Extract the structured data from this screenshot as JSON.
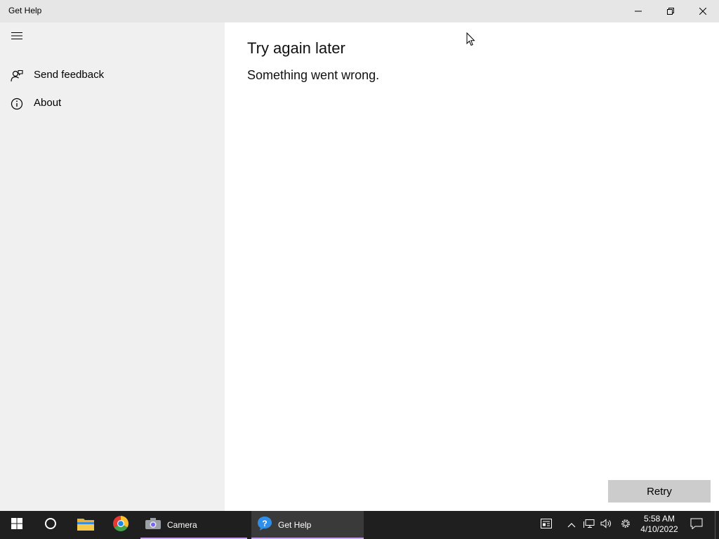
{
  "window": {
    "title": "Get Help",
    "controls": [
      "minimize-icon",
      "restore-icon",
      "close-icon"
    ]
  },
  "sidebar": {
    "menu_icon": "hamburger-icon",
    "items": [
      {
        "label": "Send feedback",
        "icon": "feedback-icon"
      },
      {
        "label": "About",
        "icon": "info-icon"
      }
    ]
  },
  "main": {
    "heading": "Try again later",
    "message": "Something went wrong.",
    "retry_label": "Retry"
  },
  "taskbar": {
    "start_icon": "windows-start-icon",
    "search_icon": "cortana-circle-icon",
    "pinned": [
      {
        "name": "file-explorer-icon"
      },
      {
        "name": "chrome-icon"
      }
    ],
    "apps": [
      {
        "label": "Camera",
        "icon": "camera-icon",
        "active": false
      },
      {
        "label": "Get Help",
        "icon": "get-help-icon",
        "active": true
      }
    ],
    "tray": {
      "time": "5:58 AM",
      "date": "4/10/2022"
    }
  },
  "colors": {
    "titlebar": "#e6e6e6",
    "sidebar": "#f0f0f0",
    "taskbar": "#1f1f1f",
    "retry_button": "#cccccc",
    "app_underline": "#c9a3f0"
  }
}
